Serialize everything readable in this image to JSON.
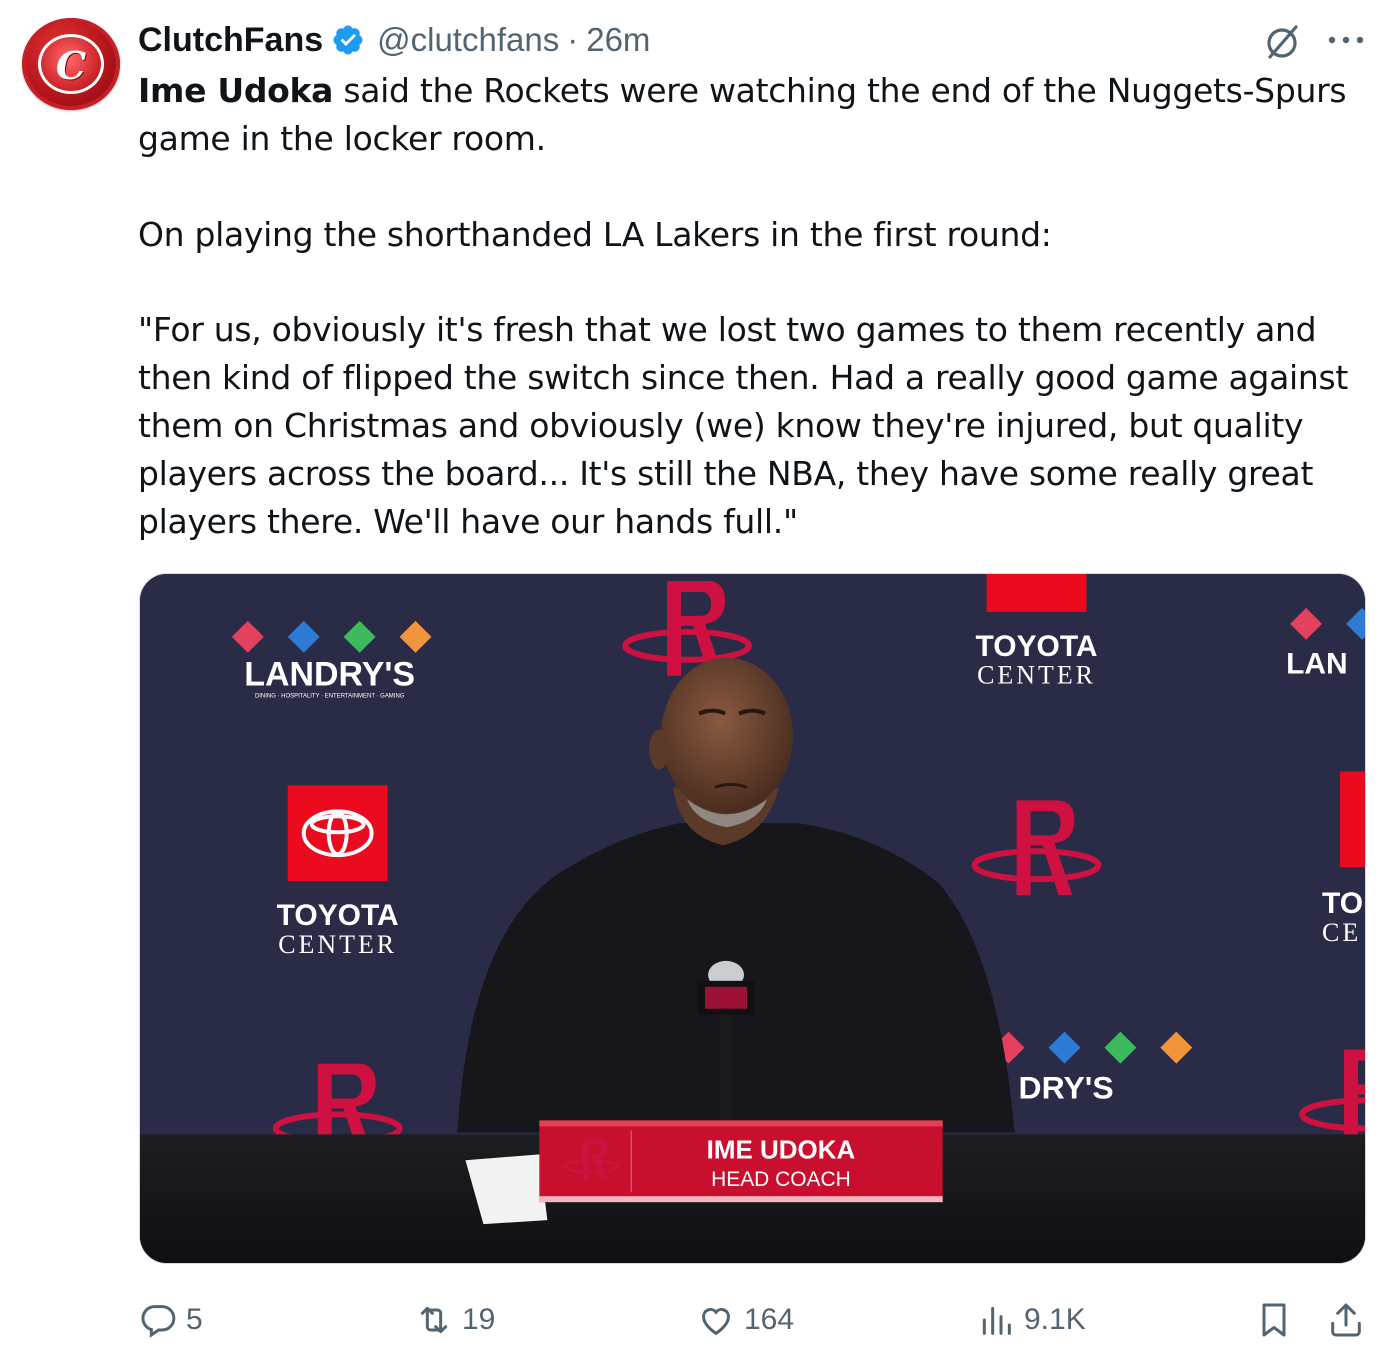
{
  "author": {
    "name": "ClutchFans",
    "handle": "@clutchfans",
    "separator": "·",
    "time": "26m",
    "avatar_letter": "C",
    "verified_color": "#1d9bf0"
  },
  "tweet": {
    "p1_bold": "Ime Udoka",
    "p1_rest": " said the Rockets were watching the end of the Nuggets-Spurs game in the locker room.",
    "p2": "On playing the shorthanded LA Lakers in the first round:",
    "p3": "\"For us, obviously it's fresh that we lost two games to them recently and then kind of flipped the switch since then. Had a really good game against them on Christmas and obviously (we) know they're injured, but quality players across the board... It's still the NBA, they have some really great players there. We'll have our hands full.\""
  },
  "media": {
    "backdrop": {
      "sponsor_landrys": "LANDRY'S",
      "sponsor_landrys_sub": "DINING · HOSPITALITY · ENTERTAINMENT · GAMING",
      "sponsor_landrys_partial_right": "LAN",
      "sponsor_landrys_partial_bottom": "DRY'S",
      "sponsor_toyota_line1": "TOYOTA",
      "sponsor_toyota_line2": "CENTER",
      "sponsor_toyota_partial_line1": "TO",
      "sponsor_toyota_partial_line2": "CE"
    },
    "lower_third": {
      "name": "IME UDOKA",
      "title": "HEAD COACH"
    },
    "colors": {
      "backdrop": "#2a2b47",
      "rockets_red": "#ce1141",
      "toyota_red": "#eb0a1e"
    }
  },
  "actions": {
    "replies": "5",
    "reposts": "19",
    "likes": "164",
    "views": "9.1K",
    "icons": [
      "reply-icon",
      "repost-icon",
      "like-icon",
      "views-icon",
      "bookmark-icon",
      "share-icon"
    ]
  },
  "colors": {
    "text": "#0f1419",
    "secondary": "#536471"
  }
}
